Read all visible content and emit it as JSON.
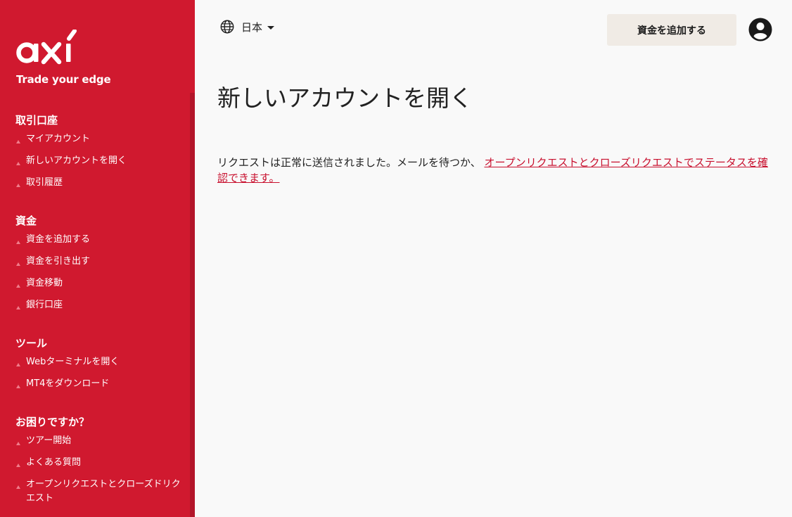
{
  "brand": {
    "logo_text": "axi",
    "tagline": "Trade your edge"
  },
  "colors": {
    "sidebar_bg": "#d0192f",
    "accent": "#c8102e",
    "button_bg": "#f0ebe5",
    "page_bg": "#f9f9f9"
  },
  "sidebar": {
    "sections": [
      {
        "heading": "取引口座",
        "items": [
          {
            "label": "マイアカウント"
          },
          {
            "label": "新しいアカウントを開く"
          },
          {
            "label": "取引履歴"
          }
        ]
      },
      {
        "heading": "資金",
        "items": [
          {
            "label": "資金を追加する"
          },
          {
            "label": "資金を引き出す"
          },
          {
            "label": "資金移動"
          },
          {
            "label": "銀行口座"
          }
        ]
      },
      {
        "heading": "ツール",
        "items": [
          {
            "label": "Webターミナルを開く"
          },
          {
            "label": "MT4をダウンロード"
          }
        ]
      },
      {
        "heading": "お困りですか？",
        "items": [
          {
            "label": "ツアー開始"
          },
          {
            "label": "よくある質問"
          },
          {
            "label": "オープンリクエストとクローズドリクエスト"
          }
        ]
      }
    ]
  },
  "header": {
    "language": {
      "icon": "globe-icon",
      "label": "日本"
    },
    "deposit_button": "資金を追加する",
    "account_icon": "user-account-icon"
  },
  "main": {
    "title": "新しいアカウントを開く",
    "message_text": "リクエストは正常に送信されました。メールを待つか、 ",
    "message_link": "オープンリクエストとクローズリクエストでステータスを確認できます。"
  }
}
